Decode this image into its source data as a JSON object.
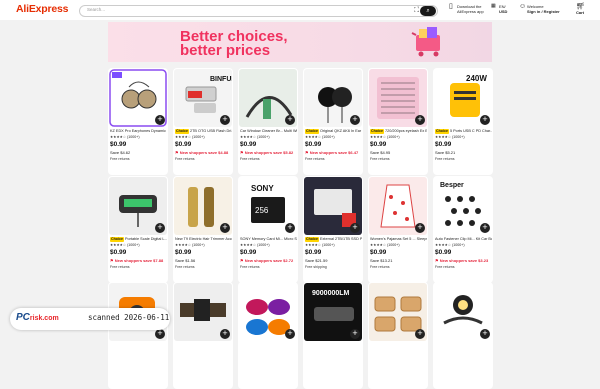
{
  "header": {
    "logo": "AliExpress",
    "search_placeholder": "Search...",
    "download": [
      "Download the",
      "AliExpress app"
    ],
    "locale": [
      "EN/",
      "USD"
    ],
    "welcome": [
      "Welcome",
      "Sign in / Register"
    ],
    "cart": {
      "count": "0",
      "label": "Cart"
    }
  },
  "banner": {
    "line1": "Better choices,",
    "line2": "better prices"
  },
  "products": [
    {
      "title": "KZ EDX Pro Earphones Dynamic In Ear Monitor HiFi...",
      "choice": false,
      "stars": "★★★★☆ (1000+)",
      "price": "$0.99",
      "was": "",
      "sub": "Save $4.62",
      "sub_red": false,
      "ret": "Free returns",
      "img": "earphones"
    },
    {
      "title": "2TB OTG USB Flash Dri... USB 3.0 Type-C For Phone...",
      "choice": true,
      "stars": "★★★★☆ (1000+)",
      "price": "$0.99",
      "was": "",
      "sub": "New shoppers save $4.88",
      "sub_red": true,
      "ret": "Free returns",
      "img": "flash"
    },
    {
      "title": "Car Window Cleaner Br... Multi Windshield Cleaning T...",
      "choice": false,
      "stars": "★★★★☆ (1000+)",
      "price": "$0.99",
      "was": "",
      "sub": "New shoppers save $5.82",
      "sub_red": true,
      "ret": "Free returns",
      "img": "wiper"
    },
    {
      "title": "Original QKZ AK6 In Ear Earphone 6 Dynamic Driver...",
      "choice": true,
      "stars": "★★★★☆ (1000+)",
      "price": "$0.99",
      "was": "",
      "sub": "New shoppers save $6.47",
      "sub_red": true,
      "ret": "Free returns",
      "img": "earphones2"
    },
    {
      "title": "720/200pcs eyelash Ex Extension Kit Fluffy Eyelash Ex...",
      "choice": true,
      "stars": "★★★★☆ (1000+)",
      "price": "$0.99",
      "was": "",
      "sub": "Save $4.95",
      "sub_red": false,
      "ret": "Free returns",
      "img": "lashes"
    },
    {
      "title": "5 Ports USB C PD Char... Fast Quick Charge 3.0 Type C...",
      "choice": true,
      "stars": "★★★★☆ (1000+)",
      "price": "$0.99",
      "was": "",
      "sub": "Save $5.21",
      "sub_red": false,
      "ret": "Free returns",
      "img": "charger"
    },
    {
      "title": "Portable Scale Digital L... LCD Display 110lb/50kg Elect...",
      "choice": true,
      "stars": "★★★★☆ (1000+)",
      "price": "$0.99",
      "was": "",
      "sub": "New shoppers save $7.88",
      "sub_red": true,
      "ret": "Free returns",
      "img": "scale"
    },
    {
      "title": "New T9 Electric Hair Trimmer Accessories | USB...",
      "choice": false,
      "stars": "★★★★☆ (1000+)",
      "price": "$0.99",
      "was": "",
      "sub": "Save $1.56",
      "sub_red": false,
      "ret": "Free returns",
      "img": "trimmer"
    },
    {
      "title": "SONY Memory Card Mi... Micro SD Cards High Speed S1...",
      "choice": false,
      "stars": "★★★★☆ (1000+)",
      "price": "$0.99",
      "was": "",
      "sub": "New shoppers save $2.72",
      "sub_red": true,
      "ret": "Free returns",
      "img": "sdcard"
    },
    {
      "title": "External 2TB/1TB SSD Portable Solid State Drive...",
      "choice": true,
      "stars": "★★★★☆ (1000+)",
      "price": "$0.99",
      "was": "",
      "sub": "Save $21.59",
      "sub_red": false,
      "ret": "Free shipping",
      "img": "ssd"
    },
    {
      "title": "Women's Pajamas Set 5 ... Sleepwear 2 PCS Short Tank T...",
      "choice": false,
      "stars": "★★★★☆ (1000+)",
      "price": "$0.99",
      "was": "",
      "sub": "Save $13.21",
      "sub_red": false,
      "ret": "Free returns",
      "img": "pajamas"
    },
    {
      "title": "Auto Fastener Clip Mi... Kit Car Body Push Retainer P...",
      "choice": false,
      "stars": "★★★★☆ (1000+)",
      "price": "$0.99",
      "was": "",
      "sub": "New shoppers save $3.23",
      "sub_red": true,
      "ret": "Free returns",
      "img": "clips"
    },
    {
      "title": "",
      "choice": false,
      "stars": "",
      "price": "",
      "was": "",
      "sub": "",
      "sub_red": false,
      "ret": "",
      "img": "tape"
    },
    {
      "title": "",
      "choice": false,
      "stars": "",
      "price": "",
      "was": "",
      "sub": "",
      "sub_red": false,
      "ret": "",
      "img": "belt"
    },
    {
      "title": "",
      "choice": false,
      "stars": "",
      "price": "",
      "was": "",
      "sub": "",
      "sub_red": false,
      "ret": "",
      "img": "glasses"
    },
    {
      "title": "",
      "choice": false,
      "stars": "",
      "price": "",
      "was": "",
      "sub": "",
      "sub_red": false,
      "ret": "",
      "img": "flashlight"
    },
    {
      "title": "",
      "choice": false,
      "stars": "",
      "price": "",
      "was": "",
      "sub": "",
      "sub_red": false,
      "ret": "",
      "img": "bowls"
    },
    {
      "title": "",
      "choice": false,
      "stars": "",
      "price": "",
      "was": "",
      "sub": "",
      "sub_red": false,
      "ret": "",
      "img": "headlamp"
    }
  ],
  "watermark": {
    "brand": "PC",
    "brand2": "risk.com",
    "stamp": "scanned 2026-06-11"
  },
  "colors": {
    "accent": "#e62e04",
    "red_text": "#e5243b",
    "choice_badge": "#ffd400",
    "banner_pink": "#f0325f"
  }
}
